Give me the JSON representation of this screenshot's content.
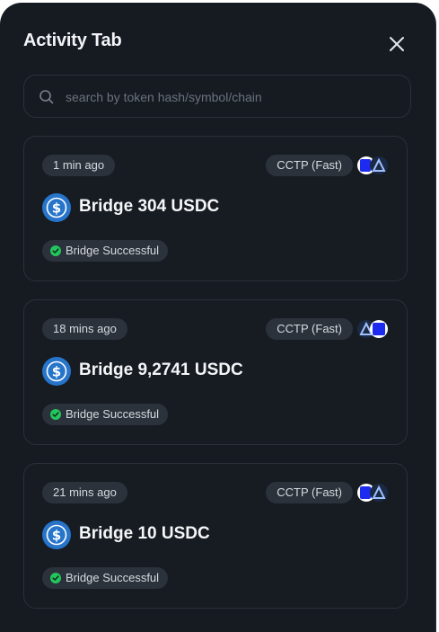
{
  "panel": {
    "title": "Activity Tab",
    "close_icon": "close-icon"
  },
  "search": {
    "placeholder": "search by token hash/symbol/chain",
    "value": "",
    "icon": "search-icon"
  },
  "activities": [
    {
      "time": "1 min ago",
      "protocol": "CCTP (Fast)",
      "title": "Bridge 304 USDC",
      "status": "Bridge Successful",
      "token_icon": "usdc-icon",
      "chains_icon": "chain-pair-icon"
    },
    {
      "time": "18 mins ago",
      "protocol": "CCTP (Fast)",
      "title": "Bridge 9,2741 USDC",
      "status": "Bridge Successful",
      "token_icon": "usdc-icon",
      "chains_icon": "chain-pair-icon"
    },
    {
      "time": "21 mins ago",
      "protocol": "CCTP (Fast)",
      "title": "Bridge 10 USDC",
      "status": "Bridge Successful",
      "token_icon": "usdc-icon",
      "chains_icon": "chain-pair-icon"
    }
  ],
  "colors": {
    "background": "#161b22",
    "card": "#171c23",
    "pill": "#2c323b",
    "success": "#22c55e",
    "usdc": "#2775ca"
  }
}
